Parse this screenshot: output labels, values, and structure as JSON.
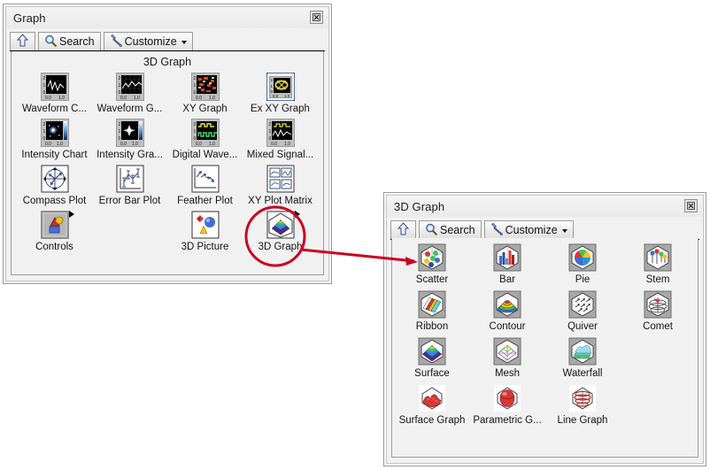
{
  "accent": {
    "annotation_red": "#cc0022",
    "window_bg": "#f1f1f1",
    "title_bg": "#efefef",
    "border": "#9a9a9a"
  },
  "windows": [
    {
      "id": "graph-palette",
      "title": "Graph",
      "close_icon": "close-icon",
      "toolbar": {
        "up_icon": "up-arrow-icon",
        "search_icon": "search-icon",
        "search_label": "Search",
        "customize_icon": "wrench-icon",
        "customize_label": "Customize",
        "customize_caret": "chevron-down-icon"
      },
      "section_header": "3D Graph",
      "items": [
        {
          "label": "Waveform C...",
          "icon": "waveform-chart-icon",
          "subpalette": false
        },
        {
          "label": "Waveform G...",
          "icon": "waveform-graph-icon",
          "subpalette": false
        },
        {
          "label": "XY Graph",
          "icon": "xy-graph-icon",
          "subpalette": false
        },
        {
          "label": "Ex XY Graph",
          "icon": "ex-xy-graph-icon",
          "subpalette": false
        },
        {
          "label": "Intensity Chart",
          "icon": "intensity-chart-icon",
          "subpalette": false
        },
        {
          "label": "Intensity Gra...",
          "icon": "intensity-graph-icon",
          "subpalette": false
        },
        {
          "label": "Digital Wave...",
          "icon": "digital-waveform-icon",
          "subpalette": false
        },
        {
          "label": "Mixed Signal...",
          "icon": "mixed-signal-graph-icon",
          "subpalette": false
        },
        {
          "label": "Compass Plot",
          "icon": "compass-plot-icon",
          "subpalette": false
        },
        {
          "label": "Error Bar Plot",
          "icon": "error-bar-plot-icon",
          "subpalette": false
        },
        {
          "label": "Feather Plot",
          "icon": "feather-plot-icon",
          "subpalette": false
        },
        {
          "label": "XY Plot Matrix",
          "icon": "xy-plot-matrix-icon",
          "subpalette": false
        },
        {
          "label": "Controls",
          "icon": "controls-icon",
          "subpalette": true
        },
        {
          "label": "",
          "icon": "",
          "subpalette": false
        },
        {
          "label": "3D Picture",
          "icon": "3d-picture-icon",
          "subpalette": false
        },
        {
          "label": "3D Graph",
          "icon": "3d-graph-icon",
          "subpalette": true
        }
      ]
    },
    {
      "id": "3d-graph-palette",
      "title": "3D Graph",
      "close_icon": "close-icon",
      "toolbar": {
        "up_icon": "up-arrow-icon",
        "search_icon": "search-icon",
        "search_label": "Search",
        "customize_icon": "wrench-icon",
        "customize_label": "Customize",
        "customize_caret": "chevron-down-icon"
      },
      "section_header": "",
      "items": [
        {
          "label": "Scatter",
          "icon": "scatter-3d-icon",
          "subpalette": false
        },
        {
          "label": "Bar",
          "icon": "bar-3d-icon",
          "subpalette": false
        },
        {
          "label": "Pie",
          "icon": "pie-3d-icon",
          "subpalette": false
        },
        {
          "label": "Stem",
          "icon": "stem-3d-icon",
          "subpalette": false
        },
        {
          "label": "Ribbon",
          "icon": "ribbon-3d-icon",
          "subpalette": false
        },
        {
          "label": "Contour",
          "icon": "contour-3d-icon",
          "subpalette": false
        },
        {
          "label": "Quiver",
          "icon": "quiver-3d-icon",
          "subpalette": false
        },
        {
          "label": "Comet",
          "icon": "comet-3d-icon",
          "subpalette": false
        },
        {
          "label": "Surface",
          "icon": "surface-3d-icon",
          "subpalette": false
        },
        {
          "label": "Mesh",
          "icon": "mesh-3d-icon",
          "subpalette": false
        },
        {
          "label": "Waterfall",
          "icon": "waterfall-3d-icon",
          "subpalette": false
        },
        {
          "label": "",
          "icon": "",
          "subpalette": false
        },
        {
          "label": "Surface Graph",
          "icon": "surface-graph-3d-icon",
          "subpalette": false
        },
        {
          "label": "Parametric G...",
          "icon": "parametric-graph-3d-icon",
          "subpalette": false
        },
        {
          "label": "Line Graph",
          "icon": "line-graph-3d-icon",
          "subpalette": false
        },
        {
          "label": "",
          "icon": "",
          "subpalette": false
        }
      ]
    }
  ],
  "annotation": {
    "name": "callout-highlight",
    "shape": "ellipse-with-arrow",
    "color": "#cc0022",
    "target_label": "3D Graph",
    "points_to": "Scatter"
  }
}
